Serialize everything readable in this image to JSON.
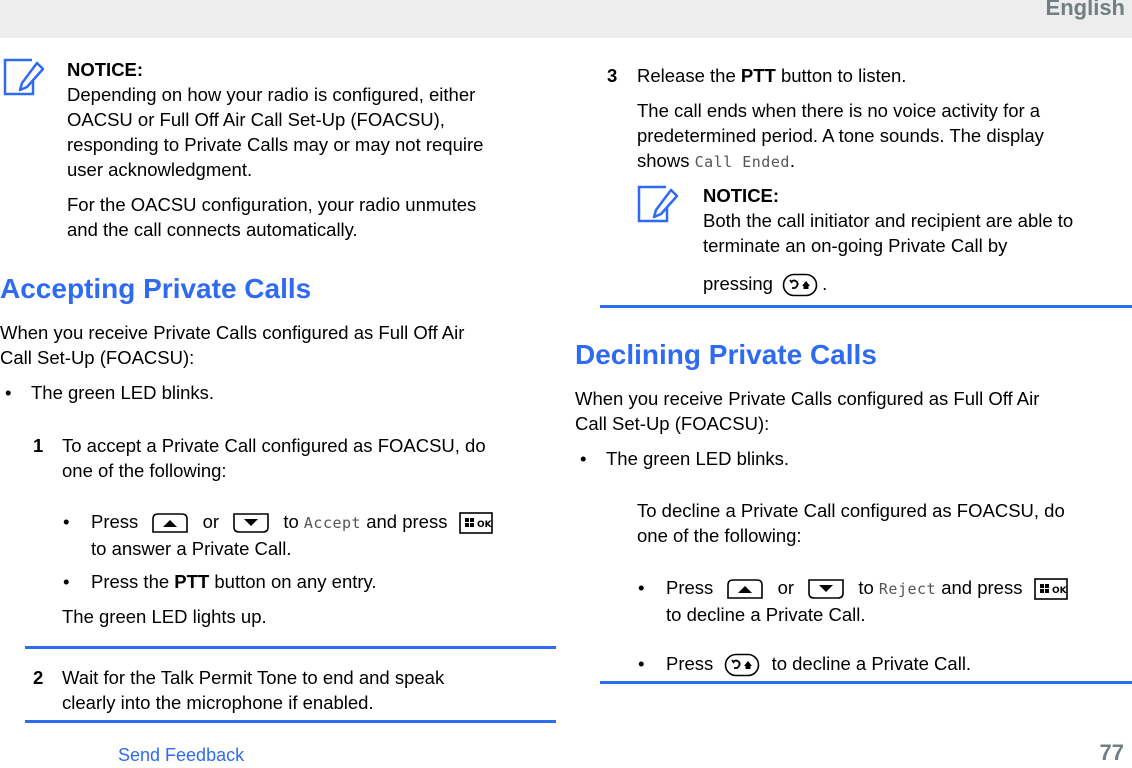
{
  "header": {
    "language": "English"
  },
  "left": {
    "notice": {
      "title": "NOTICE:",
      "line1": "Depending on how your radio is configured, either",
      "line2": "OACSU or Full Off Air Call Set-Up (FOACSU),",
      "line3": "responding to Private Calls may or may not require",
      "line4": "user acknowledgment.",
      "para2_line1": "For the OACSU configuration, your radio unmutes",
      "para2_line2": "and the call connects automatically."
    },
    "heading": "Accepting Private Calls",
    "intro_line1": "When you receive Private Calls configured as Full Off Air",
    "intro_line2": "Call Set-Up (FOACSU):",
    "bullet_led": "The green LED blinks.",
    "step1": {
      "number": "1",
      "line1": "To accept a Private Call configured as FOACSU, do",
      "line2": "one of the following:",
      "sub1_press": "Press",
      "sub1_or": "or",
      "sub1_to": "to",
      "sub1_display": "Accept",
      "sub1_and_press": "and press",
      "sub1_line2": "to answer a Private Call.",
      "sub2_prefix": "Press the",
      "sub2_bold": "PTT",
      "sub2_suffix": "button on any entry.",
      "result": "The green LED lights up."
    },
    "step2": {
      "number": "2",
      "line1": "Wait for the Talk Permit Tone to end and speak",
      "line2": "clearly into the microphone if enabled."
    }
  },
  "right": {
    "step3": {
      "number": "3",
      "prefix": "Release the",
      "bold": "PTT",
      "suffix": "button to listen.",
      "line2": "The call ends when there is no voice activity for a",
      "line3": "predetermined period. A tone sounds. The display",
      "line4_prefix": "shows",
      "line4_display": "Call Ended",
      "line4_suffix": "."
    },
    "notice": {
      "title": "NOTICE:",
      "line1": "Both the call initiator and recipient are able to",
      "line2": "terminate an on-going Private Call by",
      "line3": "pressing",
      "line3_suffix": "."
    },
    "heading": "Declining Private Calls",
    "intro_line1": "When you receive Private Calls configured as Full Off Air",
    "intro_line2": "Call Set-Up (FOACSU):",
    "bullet_led": "The green LED blinks.",
    "decline": {
      "line1": "To decline a Private Call configured as FOACSU, do",
      "line2": "one of the following:",
      "sub1_press": "Press",
      "sub1_or": "or",
      "sub1_to": "to",
      "sub1_display": "Reject",
      "sub1_and_press": "and press",
      "sub1_line2": "to decline a Private Call.",
      "sub2_press": "Press",
      "sub2_suffix": "to decline a Private Call."
    }
  },
  "footer": {
    "feedback_link": "Send Feedback",
    "page_number": "77"
  },
  "colors": {
    "accent": "#2f6bf0",
    "header_bg": "#ededed",
    "header_text": "#6f7f82"
  },
  "icons": {
    "notice": "notice-pencil-icon",
    "up": "navigation-up-key-icon",
    "down": "navigation-down-key-icon",
    "ok": "menu-ok-key-icon",
    "back_home": "back-home-key-icon"
  }
}
